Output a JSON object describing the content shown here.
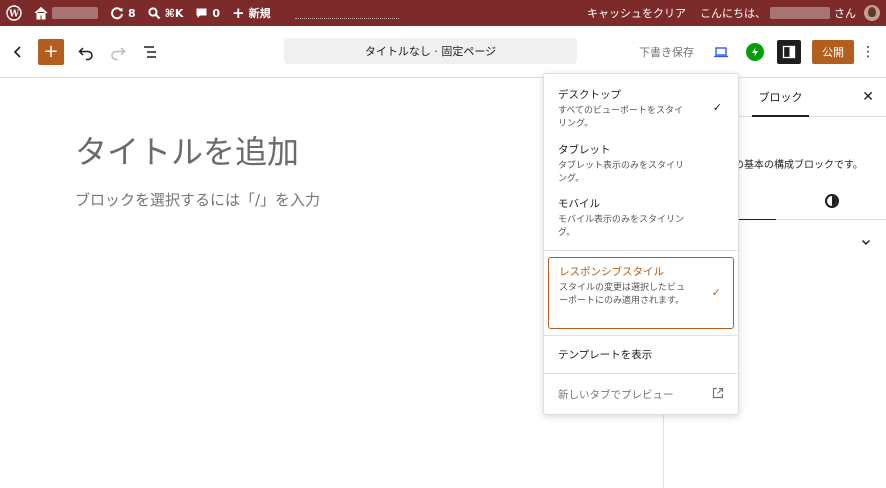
{
  "adminbar": {
    "updates_count": "8",
    "search_shortcut": "⌘K",
    "comments_count": "0",
    "new_label": "新規",
    "clear_cache": "キャッシュをクリア",
    "greeting": "こんにちは、",
    "honorific": "さん",
    "bg_color": "#7c2a2a"
  },
  "header": {
    "document_title": "タイトルなし · 固定ページ",
    "save_draft": "下書き保存",
    "publish": "公開",
    "accent_color": "#b35e1e"
  },
  "canvas": {
    "title_placeholder": "タイトルを追加",
    "block_hint": "ブロックを選択するには「/」を入力"
  },
  "sidebar": {
    "tab_block": "ブロック",
    "description": "の基本の構成ブロックです。"
  },
  "dropdown": {
    "items": [
      {
        "label": "デスクトップ",
        "desc": "すべてのビューポートをスタイリング。",
        "checked": true
      },
      {
        "label": "タブレット",
        "desc": "タブレット表示のみをスタイリング。",
        "checked": false
      },
      {
        "label": "モバイル",
        "desc": "モバイル表示のみをスタイリング。",
        "checked": false
      }
    ],
    "responsive": {
      "label": "レスポンシブスタイル",
      "desc": "スタイルの変更は選択したビューポートにのみ適用されます。",
      "checked": true
    },
    "show_template": "テンプレートを表示",
    "preview_new_tab": "新しいタブでプレビュー"
  }
}
